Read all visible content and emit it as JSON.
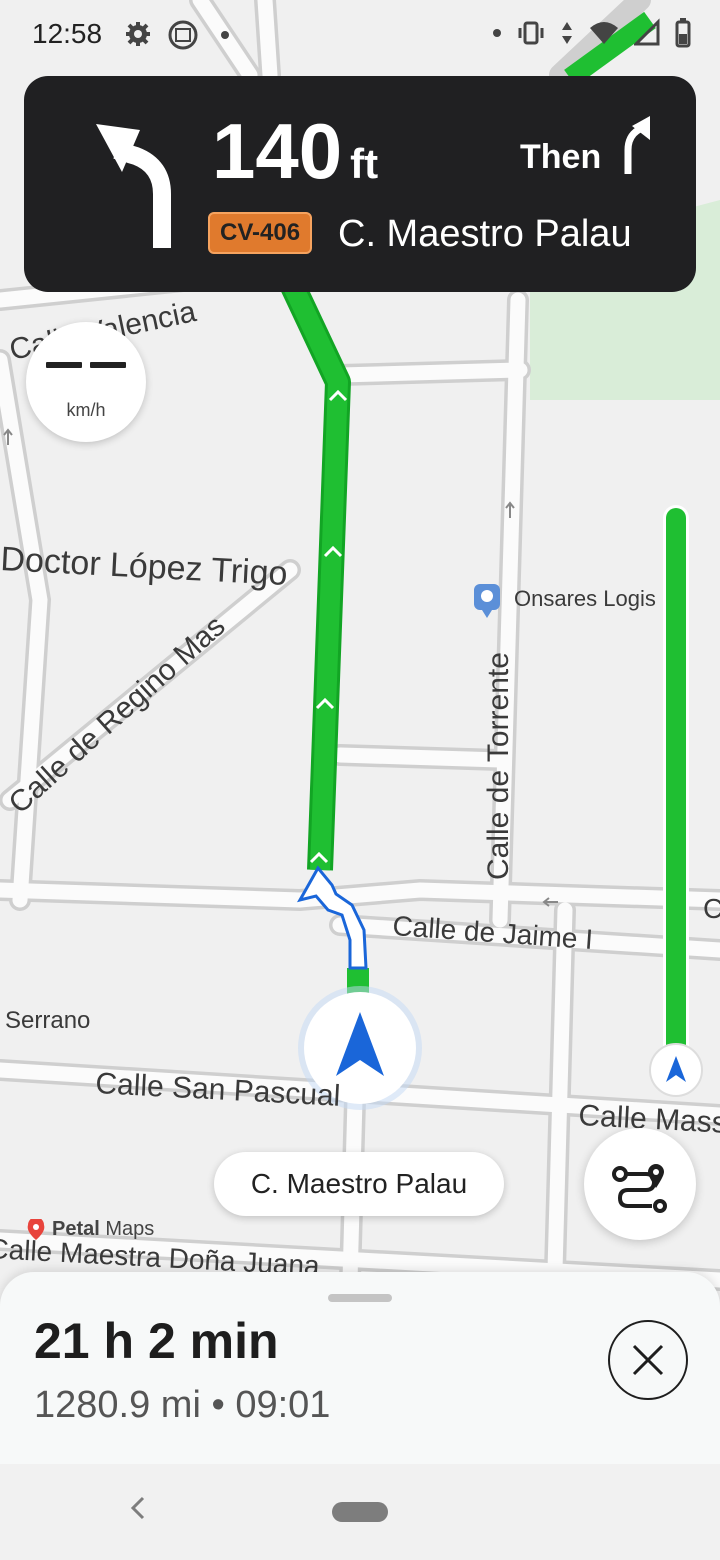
{
  "status_bar": {
    "time": "12:58"
  },
  "instruction": {
    "distance_value": "140",
    "distance_unit": "ft",
    "then_label": "Then",
    "road_badge": "CV-406",
    "street": "C. Maestro Palau",
    "badge_color": "#e07a2d"
  },
  "speed": {
    "unit": "km/h"
  },
  "map": {
    "labels": {
      "valencia": "Calle Valencia",
      "doctor": "Doctor López Trigo",
      "regino": "Calle de Regino Mas",
      "torrente": "Calle de Torrente",
      "jaime": "Calle de Jaime I",
      "serrano": "Serrano",
      "san_pascual": "Calle San Pascual",
      "mass": "Calle Mass",
      "maestra": "Calle Maestra Doña Juana",
      "poi": "Onsares Logis",
      "edge_c": "C"
    },
    "route_color": "#1fbf32",
    "brand_label": "Petal",
    "brand_suffix": "Maps"
  },
  "current_road": "C. Maestro Palau",
  "eta": {
    "duration": "21 h 2 min",
    "distance": "1280.9 mi",
    "separator": "•",
    "arrival": "09:01"
  },
  "route_progress": 0.0
}
